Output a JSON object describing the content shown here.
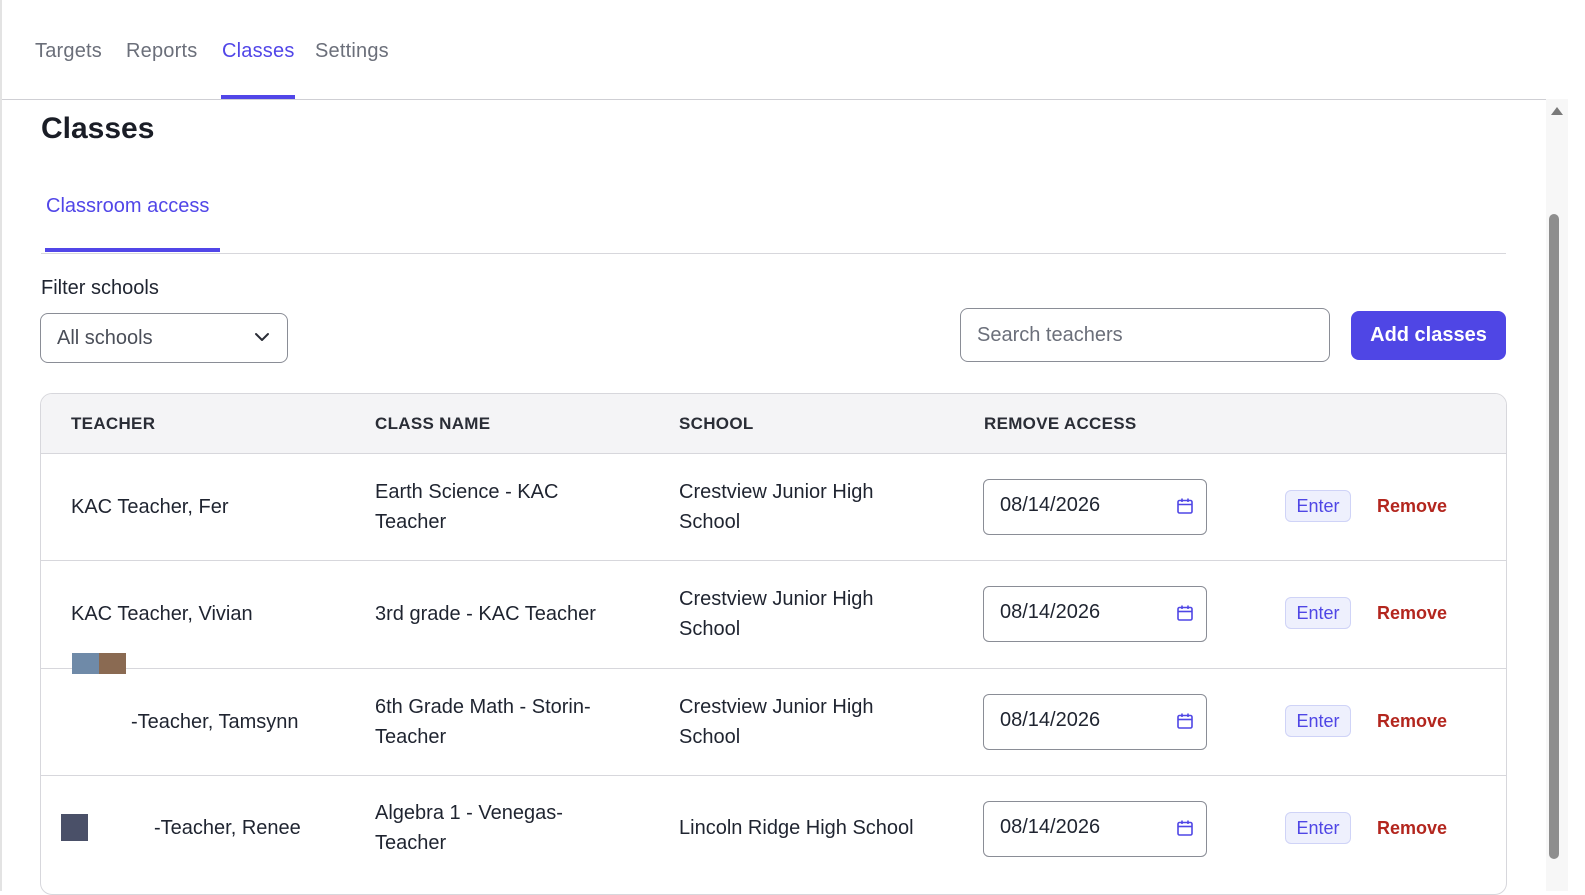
{
  "nav": {
    "tabs": [
      {
        "label": "Targets"
      },
      {
        "label": "Reports"
      },
      {
        "label": "Classes"
      },
      {
        "label": "Settings"
      }
    ],
    "active_tab": "Classes"
  },
  "page": {
    "title": "Classes",
    "subtab": "Classroom access"
  },
  "filter": {
    "label": "Filter schools",
    "selected": "All schools"
  },
  "search": {
    "placeholder": "Search teachers"
  },
  "actions": {
    "add_label": "Add classes"
  },
  "table": {
    "columns": [
      "TEACHER",
      "CLASS NAME",
      "SCHOOL",
      "REMOVE ACCESS"
    ],
    "rows": [
      {
        "teacher": "KAC Teacher, Fer",
        "class_name": "Earth Science - KAC Teacher",
        "school": "Crestview Junior High School",
        "remove_date": "08/14/2026",
        "enter": "Enter",
        "remove": "Remove"
      },
      {
        "teacher": "KAC Teacher, Vivian",
        "class_name": "3rd grade - KAC Teacher",
        "school": "Crestview Junior High School",
        "remove_date": "08/14/2026",
        "enter": "Enter",
        "remove": "Remove"
      },
      {
        "teacher": "-Teacher, Tamsynn",
        "class_name": "6th Grade Math - Storin-Teacher",
        "school": "Crestview Junior High School",
        "remove_date": "08/14/2026",
        "enter": "Enter",
        "remove": "Remove"
      },
      {
        "teacher": "-Teacher, Renee",
        "class_name": "Algebra 1 - Venegas-Teacher",
        "school": "Lincoln Ridge High School",
        "remove_date": "08/14/2026",
        "enter": "Enter",
        "remove": "Remove"
      }
    ]
  },
  "colors": {
    "accent": "#4f46e5",
    "remove": "#b3261e"
  }
}
